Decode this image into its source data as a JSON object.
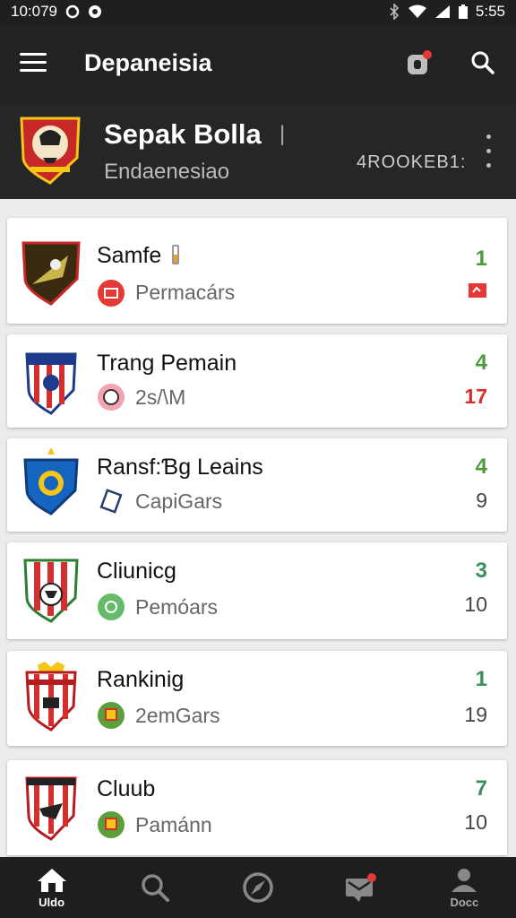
{
  "status_bar": {
    "time": "10:07",
    "time_suffix": "9",
    "clock_right": "5:55"
  },
  "app_bar": {
    "title": "Depaneisia"
  },
  "team": {
    "name": "Sepak Bolla",
    "pipe": "|",
    "subtitle": "Endaenesiao",
    "code": "4ROOKEB1:"
  },
  "cards": [
    {
      "title": "Samfe",
      "subtitle": "Permacárs",
      "number": "1",
      "number_color": "#4a9b3a",
      "value": ""
    },
    {
      "title": "Trang Pemain",
      "subtitle": "2s/\\M",
      "number": "4",
      "number_color": "#4a9b3a",
      "value": "17"
    },
    {
      "title": "Ransf:Ɓg Leains",
      "subtitle": "CapiGars",
      "number": "4",
      "number_color": "#4a9b3a",
      "value": "9"
    },
    {
      "title": "Cliunicg",
      "subtitle": "Pemóars",
      "number": "3",
      "number_color": "#3a8f5a",
      "value": "10"
    },
    {
      "title": "Rankinig",
      "subtitle": "2emGars",
      "number": "1",
      "number_color": "#3a8f5a",
      "value": "19"
    },
    {
      "title": "Cluub",
      "subtitle": "Pamánn",
      "number": "7",
      "number_color": "#3a8f5a",
      "value": "10"
    }
  ],
  "bottom_nav": {
    "home_label": "Uldo",
    "profile_label": "Docc"
  },
  "colors": {
    "accent_red": "#d32f2f",
    "accent_green": "#4a9b3a",
    "bar_dark": "#222222"
  }
}
